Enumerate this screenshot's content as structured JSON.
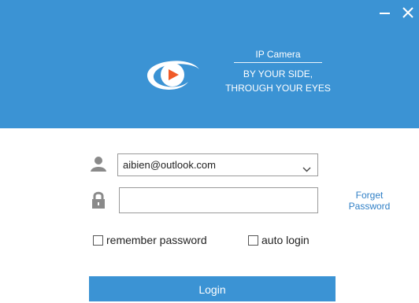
{
  "window": {
    "minimize_icon": "minimize-icon",
    "close_icon": "close-icon"
  },
  "brand": {
    "title": "IP Camera",
    "line1": "BY YOUR SIDE,",
    "line2": "THROUGH YOUR EYES",
    "accent_color": "#3b93d4",
    "play_color": "#f05a28"
  },
  "login_form": {
    "account_value": "aibien@outlook.com",
    "password_value": "",
    "forget_line1": "Forget",
    "forget_line2": "Password",
    "remember_label": "remember password",
    "remember_checked": false,
    "auto_login_label": "auto login",
    "auto_login_checked": false,
    "login_label": "Login"
  }
}
